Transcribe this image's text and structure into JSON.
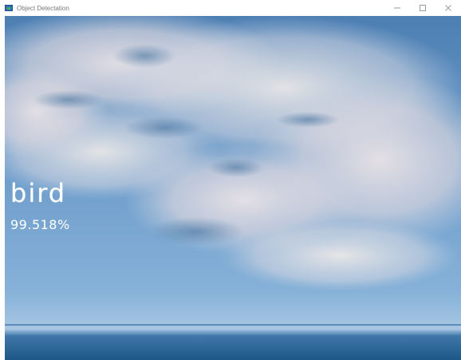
{
  "window": {
    "title": "Object Detectation",
    "app_icon": "app-window-icon",
    "controls": {
      "minimize_icon": "minimize-icon",
      "maximize_icon": "maximize-icon",
      "close_icon": "close-icon"
    }
  },
  "detection": {
    "label": "bird",
    "confidence": "99.518%"
  },
  "colors": {
    "sky_top": "#5f8fbf",
    "sky_bottom": "#7ca6cf",
    "cloud": "#e7e1e6",
    "sea": "#1f5e8e",
    "text": "#ffffff"
  }
}
